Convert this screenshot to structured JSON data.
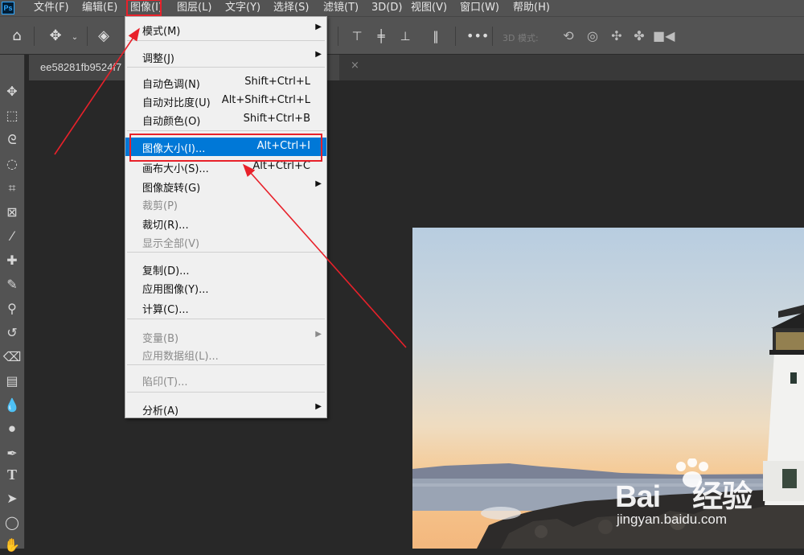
{
  "app": {
    "logo": "Ps"
  },
  "menubar": {
    "items": [
      "文件(F)",
      "编辑(E)",
      "图像(I)",
      "图层(L)",
      "文字(Y)",
      "选择(S)",
      "滤镜(T)",
      "3D(D)",
      "视图(V)",
      "窗口(W)",
      "帮助(H)"
    ],
    "active": "图像(I)"
  },
  "options_bar": {
    "mode_3d": "3D 模式:"
  },
  "document_tab": {
    "title": "ee58281fb9524f7",
    "close": "×"
  },
  "image_menu": {
    "items": [
      {
        "label": "模式(M)",
        "shortcut": "",
        "submenu": true,
        "enabled": true
      },
      {
        "label": "调整(J)",
        "shortcut": "",
        "submenu": true,
        "enabled": true
      },
      {
        "label": "自动色调(N)",
        "shortcut": "Shift+Ctrl+L",
        "submenu": false,
        "enabled": true
      },
      {
        "label": "自动对比度(U)",
        "shortcut": "Alt+Shift+Ctrl+L",
        "submenu": false,
        "enabled": true
      },
      {
        "label": "自动颜色(O)",
        "shortcut": "Shift+Ctrl+B",
        "submenu": false,
        "enabled": true
      },
      {
        "label": "图像大小(I)...",
        "shortcut": "Alt+Ctrl+I",
        "submenu": false,
        "enabled": true,
        "highlighted": true
      },
      {
        "label": "画布大小(S)...",
        "shortcut": "Alt+Ctrl+C",
        "submenu": false,
        "enabled": true
      },
      {
        "label": "图像旋转(G)",
        "shortcut": "",
        "submenu": true,
        "enabled": true
      },
      {
        "label": "裁剪(P)",
        "shortcut": "",
        "submenu": false,
        "enabled": false
      },
      {
        "label": "裁切(R)...",
        "shortcut": "",
        "submenu": false,
        "enabled": true
      },
      {
        "label": "显示全部(V)",
        "shortcut": "",
        "submenu": false,
        "enabled": false
      },
      {
        "label": "复制(D)...",
        "shortcut": "",
        "submenu": false,
        "enabled": true
      },
      {
        "label": "应用图像(Y)...",
        "shortcut": "",
        "submenu": false,
        "enabled": true
      },
      {
        "label": "计算(C)...",
        "shortcut": "",
        "submenu": false,
        "enabled": true
      },
      {
        "label": "变量(B)",
        "shortcut": "",
        "submenu": true,
        "enabled": false
      },
      {
        "label": "应用数据组(L)...",
        "shortcut": "",
        "submenu": false,
        "enabled": false
      },
      {
        "label": "陷印(T)...",
        "shortcut": "",
        "submenu": false,
        "enabled": false
      },
      {
        "label": "分析(A)",
        "shortcut": "",
        "submenu": true,
        "enabled": true
      }
    ]
  },
  "watermark": {
    "brand": "Bai",
    "brand_cn": "经验",
    "url": "jingyan.baidu.com"
  },
  "colors": {
    "highlight": "#0078d7",
    "annotation": "#e8212a",
    "ui_dark": "#535353"
  }
}
